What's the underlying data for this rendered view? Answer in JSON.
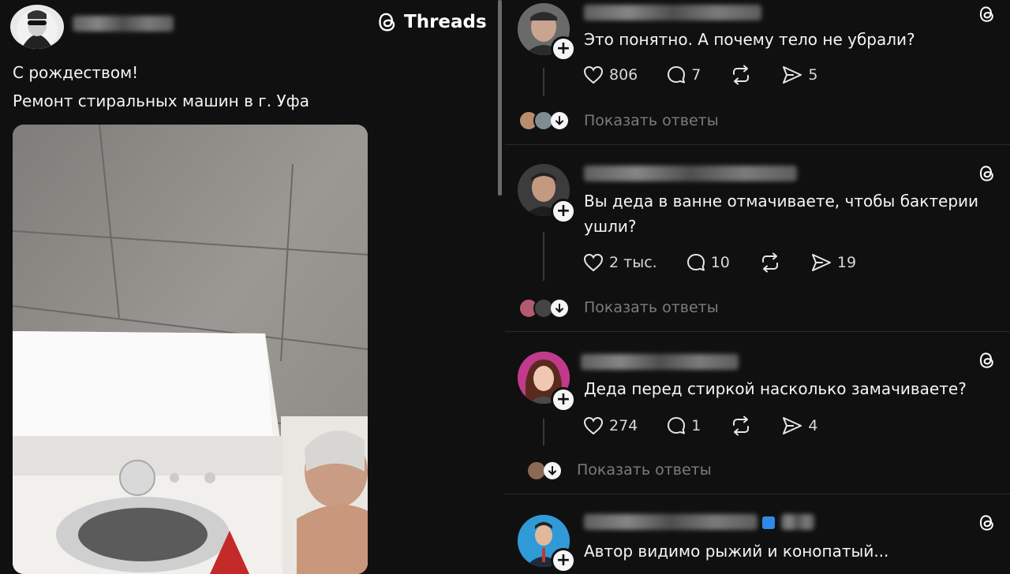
{
  "brand": {
    "name": "Threads"
  },
  "post": {
    "line1": "С рождеством!",
    "line2": "Ремонт стиральных машин в г. Уфа",
    "photo_desc": "photo"
  },
  "comments": [
    {
      "text": "Это понятно. А почему тело не убрали?",
      "likes": "806",
      "replies": "7",
      "shares": "5",
      "show_replies": "Показать ответы"
    },
    {
      "text": "Вы деда в ванне отмачиваете, чтобы бактерии ушли?",
      "likes": "2 тыс.",
      "replies": "10",
      "shares": "19",
      "show_replies": "Показать ответы"
    },
    {
      "text": "Деда перед стиркой насколько замачиваете?",
      "likes": "274",
      "replies": "1",
      "shares": "4",
      "show_replies": "Показать ответы"
    },
    {
      "text": "Автор видимо рыжий и конопатый..."
    }
  ],
  "colors": {
    "background": "#101010",
    "text": "#f3f5f7",
    "muted": "#7c7c7c",
    "verified": "#2e8ae6"
  }
}
